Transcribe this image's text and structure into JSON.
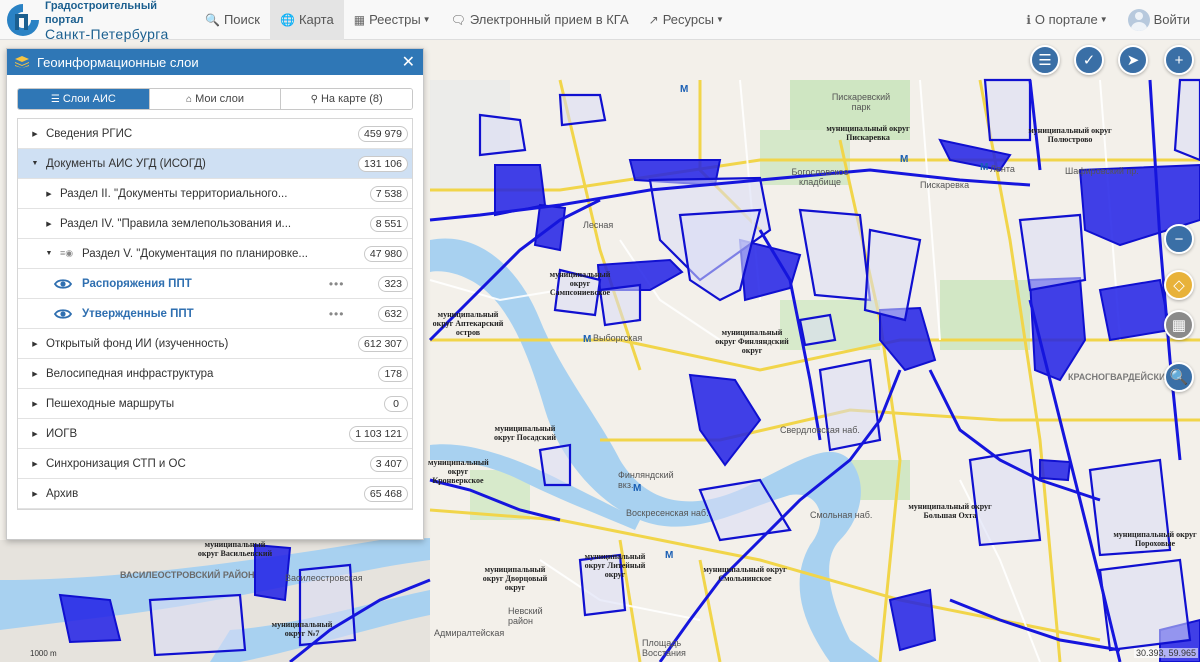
{
  "header": {
    "logo_line1": "Градостроительный портал",
    "logo_line2": "Санкт-Петербурга",
    "nav": [
      {
        "label": "Поиск",
        "icon": "search-icon"
      },
      {
        "label": "Карта",
        "icon": "globe-icon",
        "active": true
      },
      {
        "label": "Реестры",
        "icon": "table-icon",
        "dropdown": true
      },
      {
        "label": "Электронный прием в КГА",
        "icon": "chat-icon"
      },
      {
        "label": "Ресурсы",
        "icon": "external-link-icon",
        "dropdown": true
      }
    ],
    "about_label": "О портале",
    "login_label": "Войти"
  },
  "panel": {
    "title": "Геоинформационные слои",
    "tabs": [
      {
        "label": "Слои АИС",
        "icon": "list-icon",
        "active": true
      },
      {
        "label": "Мои слои",
        "icon": "home-icon"
      },
      {
        "label": "На карте (8)",
        "icon": "map-marker-icon"
      }
    ],
    "layers": [
      {
        "label": "Сведения РГИС",
        "count": "459 979",
        "level": 0,
        "expanded": false
      },
      {
        "label": "Документы АИС УГД (ИСОГД)",
        "count": "131 106",
        "level": 0,
        "expanded": true,
        "selected": true
      },
      {
        "label": "Раздел II. \"Документы территориального...",
        "count": "7 538",
        "level": 1,
        "expanded": false
      },
      {
        "label": "Раздел IV. \"Правила землепользования и...",
        "count": "8 551",
        "level": 1,
        "expanded": false
      },
      {
        "label": "Раздел V. \"Документация по планировке...",
        "count": "47 980",
        "level": 1,
        "expanded": true
      },
      {
        "label": "Распоряжения ППТ",
        "count": "323",
        "level": 2,
        "visible": true
      },
      {
        "label": "Утвержденные ППТ",
        "count": "632",
        "level": 2,
        "visible": true
      },
      {
        "label": "Открытый фонд ИИ (изученность)",
        "count": "612 307",
        "level": 0,
        "expanded": false
      },
      {
        "label": "Велосипедная инфраструктура",
        "count": "178",
        "level": 0,
        "expanded": false
      },
      {
        "label": "Пешеходные маршруты",
        "count": "0",
        "level": 0,
        "expanded": false
      },
      {
        "label": "ИОГВ",
        "count": "1 103 121",
        "level": 0,
        "expanded": false
      },
      {
        "label": "Синхронизация СТП и ОС",
        "count": "3 407",
        "level": 0,
        "expanded": false
      },
      {
        "label": "Архив",
        "count": "65 468",
        "level": 0,
        "expanded": false
      }
    ]
  },
  "map": {
    "labels": [
      "муниципальный округ Пискаревка",
      "муниципальный округ Полюстрово",
      "муниципальный округ Сампсониевское",
      "муниципальный округ Финляндский округ",
      "муниципальный округ Посадский",
      "муниципальный округ Кронверкское",
      "муниципальный округ Литейный округ",
      "муниципальный округ Дворцовый округ",
      "муниципальный округ Смольнинское",
      "муниципальный округ Большая Охта",
      "муниципальный округ Пороховые",
      "муниципальный округ Васильевский",
      "муниципальный округ №7",
      "муниципальный округ Аптекарский остров"
    ],
    "streets": [
      "Пискаревский парк",
      "Богословское кладбище",
      "Пискаревка",
      "Лесная",
      "Выборгская",
      "Финляндский вкз.",
      "Свердловская наб.",
      "Воскресенская наб.",
      "Смольная наб.",
      "ВАСИЛЕОСТРОВСКИЙ РАЙОН",
      "Василеостровская",
      "Невский район",
      "Площадь Восстания",
      "Адмиралтейская",
      "Лента",
      "КРАСНОГВАРДЕЙСКИЙ",
      "Шафировский пр."
    ],
    "scale_label": "1000 m",
    "coords": "30.393, 59.965"
  },
  "controls": [
    "layers-list-icon",
    "ruler-icon",
    "locate-icon",
    "zoom-in-icon",
    "zoom-out-icon",
    "basemap-icon",
    "overlay-icon",
    "search-map-icon"
  ],
  "colors": {
    "accent": "#2f77b6",
    "overlay": "#1414e0",
    "selected_row": "#cfe0f3"
  }
}
